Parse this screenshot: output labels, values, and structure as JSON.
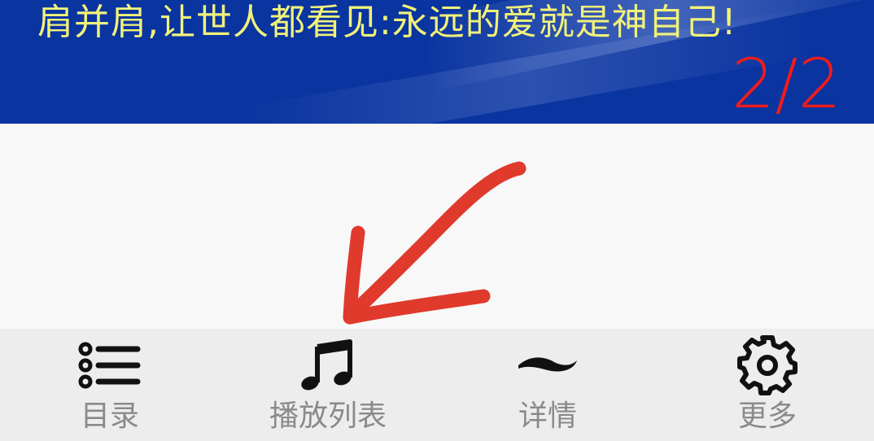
{
  "lyrics": {
    "current_line": "肩并肩,让世人都看见:永远的爱就是神自己!",
    "page_indicator": "2/2"
  },
  "toolbar": {
    "items": [
      {
        "label": "目录",
        "icon": "list-icon"
      },
      {
        "label": "播放列表",
        "icon": "music-note-icon"
      },
      {
        "label": "详情",
        "icon": "wave-icon"
      },
      {
        "label": "更多",
        "icon": "gear-icon"
      }
    ]
  },
  "colors": {
    "banner_bg": "#0a34a0",
    "lyric_text": "#f1f27a",
    "page_indicator": "#ee1c1c",
    "toolbar_bg": "#ededed",
    "toolbar_label": "#8a8a8a",
    "annotation_arrow": "#e03a2c"
  }
}
